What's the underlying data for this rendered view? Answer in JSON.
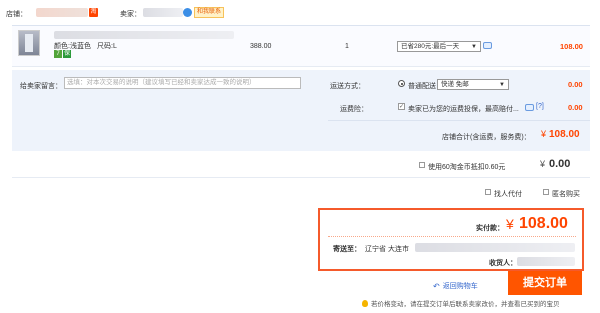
{
  "shop": {
    "label": "店铺：",
    "tao_badge": "淘",
    "seller_label": "卖家：",
    "contact_label": "和我联系"
  },
  "item": {
    "color_line": "颜色:浅蓝色",
    "size_line": "尺码:L",
    "badge_a": "7",
    "badge_b": "保",
    "unit_price": "388.00",
    "quantity": "1",
    "promo_select": "已省280元:最后一天",
    "subtotal": "108.00"
  },
  "message": {
    "label": "给卖家留言：",
    "placeholder": "选填：对本次交易的说明（建议填写已经和卖家达成一致的说明）"
  },
  "shipping": {
    "label": "运送方式：",
    "option": "普通配送",
    "select": "快递 免邮",
    "fee": "0.00"
  },
  "insurance": {
    "label": "运费险：",
    "text": "卖家已为您的运费投保，最高赔付...",
    "help": "[?]",
    "fee": "0.00"
  },
  "shop_total": {
    "label": "店铺合计(含运费，服务费)：",
    "currency": "¥",
    "value": "108.00"
  },
  "coins": {
    "label": "使用60淘金币抵扣0.60元",
    "currency": "¥",
    "value": "0.00"
  },
  "options": {
    "pay_for_me": "找人代付",
    "anonymous": "匿名购买"
  },
  "summary": {
    "paid_label": "实付款：",
    "currency": "¥",
    "paid_value": "108.00",
    "ship_to_label": "寄送至：",
    "address_start": "辽宁省 大连市",
    "receiver_label": "收货人："
  },
  "actions": {
    "back_to_cart": "返回购物车",
    "submit_order": "提交订单"
  },
  "notice": {
    "text": "若价格变动，请在提交订单后联系卖家改价，并查看已买到的宝贝"
  },
  "colors": {
    "accent": "#ff4400",
    "submit_bg": "#f50",
    "section_bg": "#eef3fb",
    "link": "#3366cc"
  }
}
